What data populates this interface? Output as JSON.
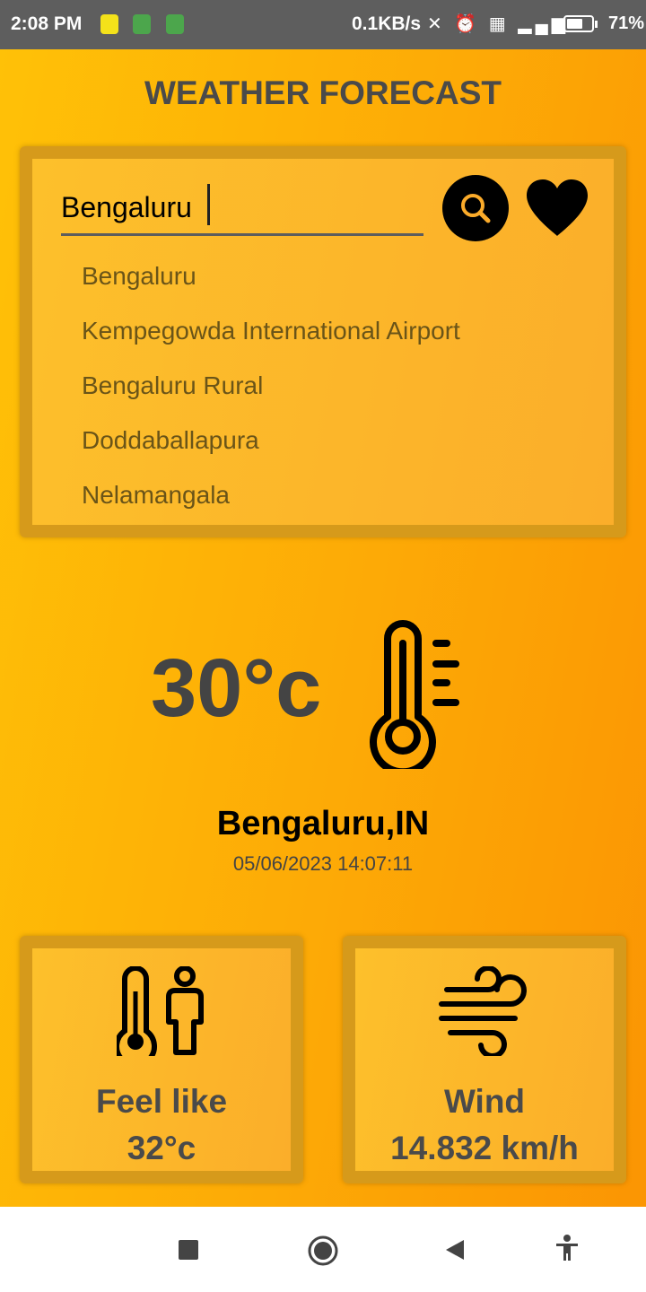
{
  "status_bar": {
    "time": "2:08 PM",
    "speed": "0.1KB/s",
    "icons": "✕ ⏰ ▦ ▂▄▆",
    "battery": "71%",
    "battery_level": 0.71
  },
  "app": {
    "title": "WEATHER FORECAST",
    "search": {
      "value": "Bengaluru",
      "suggestions": [
        "Bengaluru",
        "Kempegowda International Airport",
        "Bengaluru Rural",
        "Doddaballapura",
        "Nelamangala"
      ]
    },
    "current": {
      "temperature": "30°c",
      "location": "Bengaluru,IN",
      "datetime": "05/06/2023 14:07:11"
    },
    "feel_like": {
      "label": "Feel like",
      "value": "32°c"
    },
    "wind": {
      "label": "Wind",
      "value": "14.832 km/h"
    }
  },
  "icons": {
    "search": "search-icon",
    "favorite": "heart-icon",
    "temperature": "thermometer-icon",
    "feel_like": "thermometer-person-icon",
    "wind": "wind-icon"
  },
  "colors": {
    "accent": "#ffc107",
    "text_dark": "#4a4a4a",
    "card_border": "#d69a1b"
  }
}
